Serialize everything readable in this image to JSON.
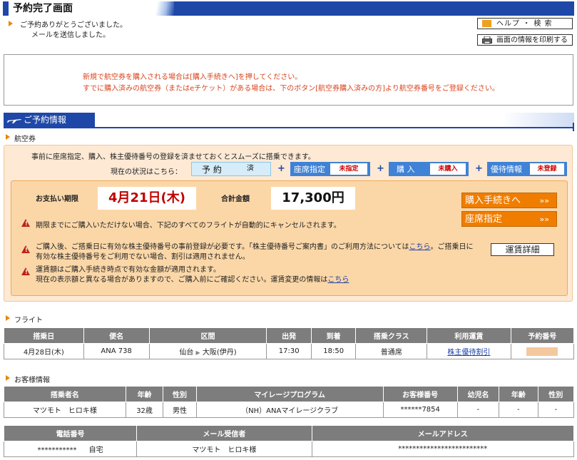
{
  "page": {
    "title": "予約完了画面",
    "thanks_line1": "ご予約ありがとうございました。",
    "thanks_line2": "メールを送信しました。",
    "help_button": "ヘルプ ・ 検 索",
    "print_button": "画面の情報を印刷する"
  },
  "notice": {
    "line1": "新規で航空券を購入される場合は[購入手続きへ]を押してください。",
    "line2": "すでに購入済みの航空券（またはeチケット）がある場合は、下のボタン[航空券購入済みの方]より航空券番号をご登録ください。"
  },
  "reservation": {
    "section_title": "ご予約情報",
    "ticket_label": "航空券",
    "intro": "事前に座席指定、購入、株主優待番号の登録を済ませておくとスムーズに搭乗できます。",
    "status_prefix": "現在の状況はこちら：",
    "statuses": [
      {
        "label": "予  約",
        "value": "済"
      },
      {
        "label": "座席指定",
        "value": "未指定"
      },
      {
        "label": "購  入",
        "value": "未購入"
      },
      {
        "label": "優待情報",
        "value": "未登録"
      }
    ],
    "plus": "+",
    "deadline_label": "お支払い期限",
    "deadline_value": "4月21日(木)",
    "total_label": "合計金額",
    "total_value": "17,300円",
    "warn1": "期限までにご購入いただけない場合、下記のすべてのフライトが自動的にキャンセルされます。",
    "warn2_line1_a": "ご購入後、ご搭乗日に有効な株主優待番号の事前登録が必要です。「株主優待番号ご案内書」のご利用方法については",
    "warn2_link": "こちら",
    "warn2_line1_b": "。ご搭乗日に",
    "warn2_line2": "有効な株主優待番号をご利用でない場合、割引は適用されません。",
    "warn3_line1": "運賃額はご購入手続き時点で有効な金額が適用されます。",
    "warn3_line2_a": "現在の表示額と異なる場合がありますので、ご購入前にご確認ください。運賃変更の情報は",
    "warn3_link": "こちら",
    "purchase_button": "購入手続きへ",
    "seat_button": "座席指定",
    "chevron": "»»",
    "fare_button": "運賃詳細"
  },
  "flight": {
    "label": "フライト",
    "headers": [
      "搭乗日",
      "便名",
      "区間",
      "出発",
      "到着",
      "搭乗クラス",
      "利用運賃",
      "予約番号"
    ],
    "row": {
      "date": "4月28日(木)",
      "flight_no": "ANA 738",
      "from": "仙台",
      "arrow": "▶",
      "to": "大阪(伊丹)",
      "dep": "17:30",
      "arr": "18:50",
      "class": "普通席",
      "fare": "株主優待割引"
    }
  },
  "customer": {
    "label": "お客様情報",
    "headers": [
      "搭乗者名",
      "年齢",
      "性別",
      "マイレージプログラム",
      "お客様番号",
      "幼児名",
      "年齢",
      "性別"
    ],
    "row": [
      "マツモト　ヒロキ様",
      "32歳",
      "男性",
      "（NH）ANAマイレージクラブ",
      "******7854",
      "-",
      "-",
      "-"
    ],
    "contact_headers": [
      "電話番号",
      "メール受信者",
      "メールアドレス"
    ],
    "contact_row": {
      "phone": "***********",
      "phone_type": "自宅",
      "recipient": "マツモト　ヒロキ様",
      "email": "*************************"
    }
  }
}
